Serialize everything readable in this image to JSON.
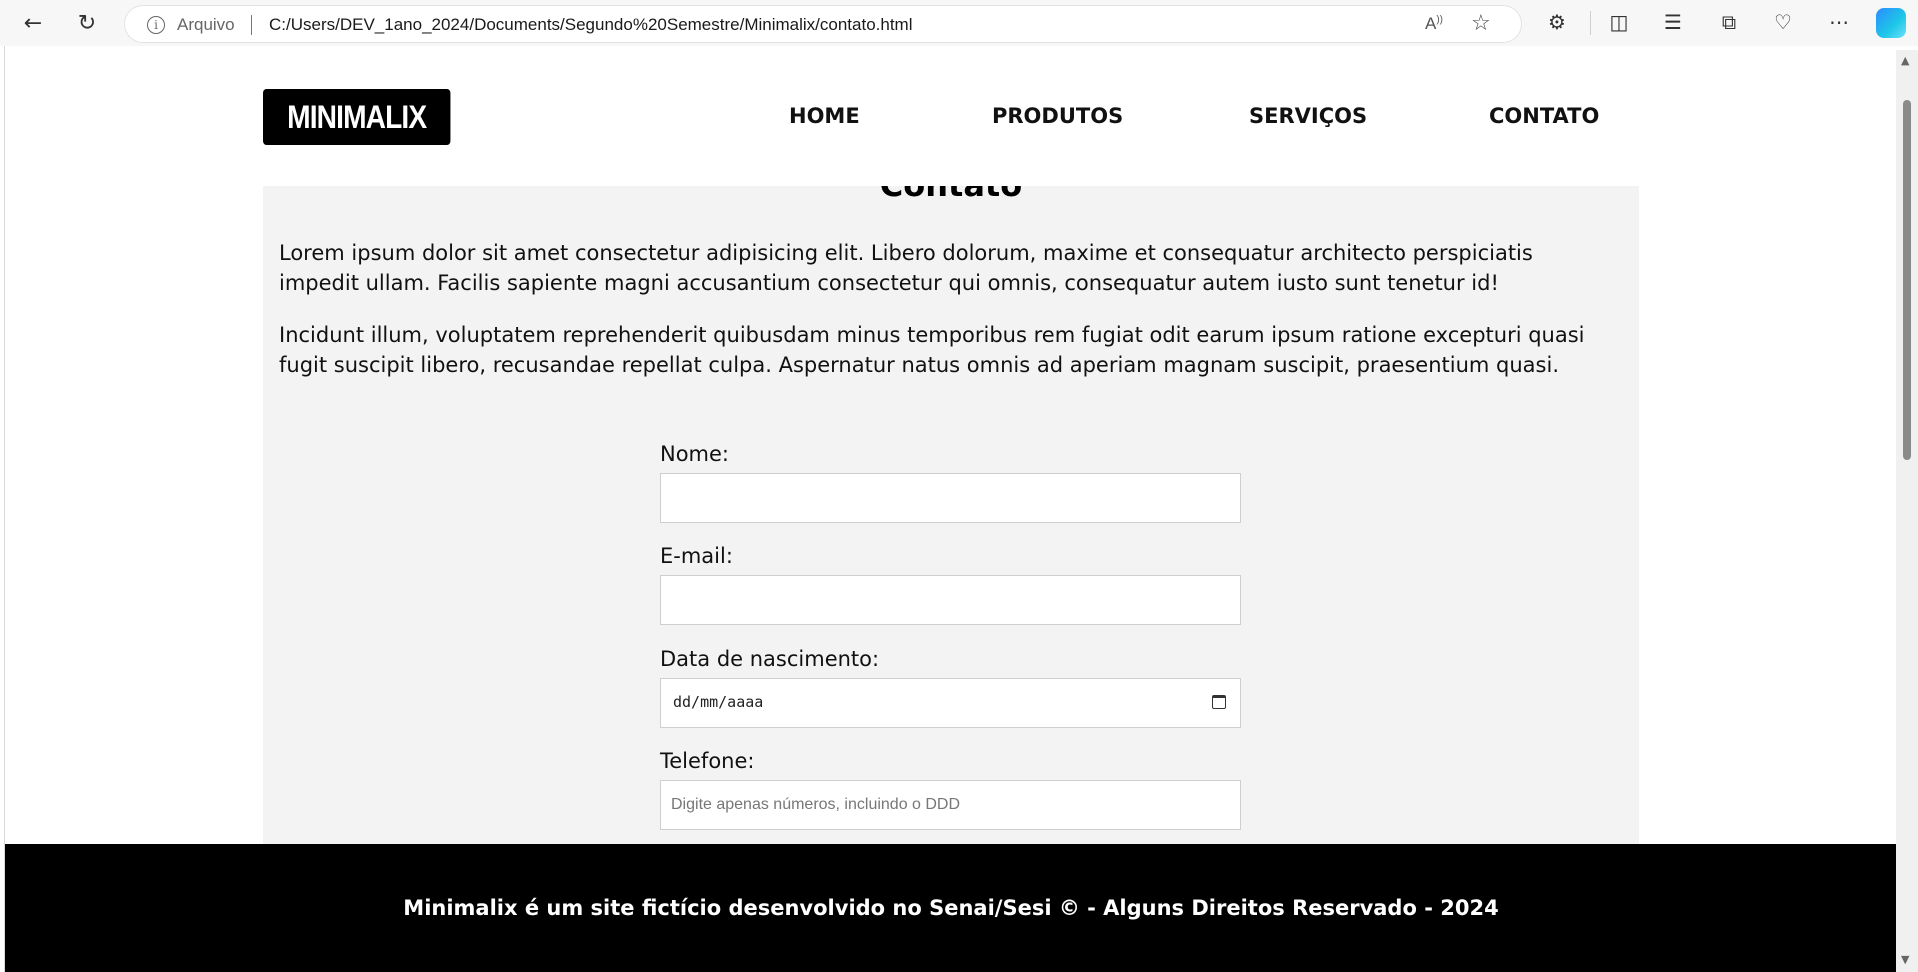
{
  "browser": {
    "address_label": "Arquivo",
    "url": "C:/Users/DEV_1ano_2024/Documents/Segundo%20Semestre/Minimalix/contato.html"
  },
  "header": {
    "logo": "MINIMALIX",
    "nav": [
      "HOME",
      "PRODUTOS",
      "SERVIÇOS",
      "CONTATO"
    ]
  },
  "main": {
    "title": "Contato",
    "paragraphs": [
      "Lorem ipsum dolor sit amet consectetur adipisicing elit. Libero dolorum, maxime et consequatur architecto perspiciatis impedit ullam. Facilis sapiente magni accusantium consectetur qui omnis, consequatur autem iusto sunt tenetur id!",
      "Incidunt illum, voluptatem reprehenderit quibusdam minus temporibus rem fugiat odit earum ipsum ratione excepturi quasi fugit suscipit libero, recusandae repellat culpa. Aspernatur natus omnis ad aperiam magnam suscipit, praesentium quasi."
    ]
  },
  "form": {
    "name_label": "Nome:",
    "email_label": "E-mail:",
    "birth_label": "Data de nascimento:",
    "birth_placeholder": "dd/mm/aaaa",
    "phone_label": "Telefone:",
    "phone_placeholder": "Digite apenas números, incluindo o DDD"
  },
  "footer": {
    "text": "Minimalix é um site fictício desenvolvido no Senai/Sesi © - Alguns Direitos Reservado - 2024"
  }
}
